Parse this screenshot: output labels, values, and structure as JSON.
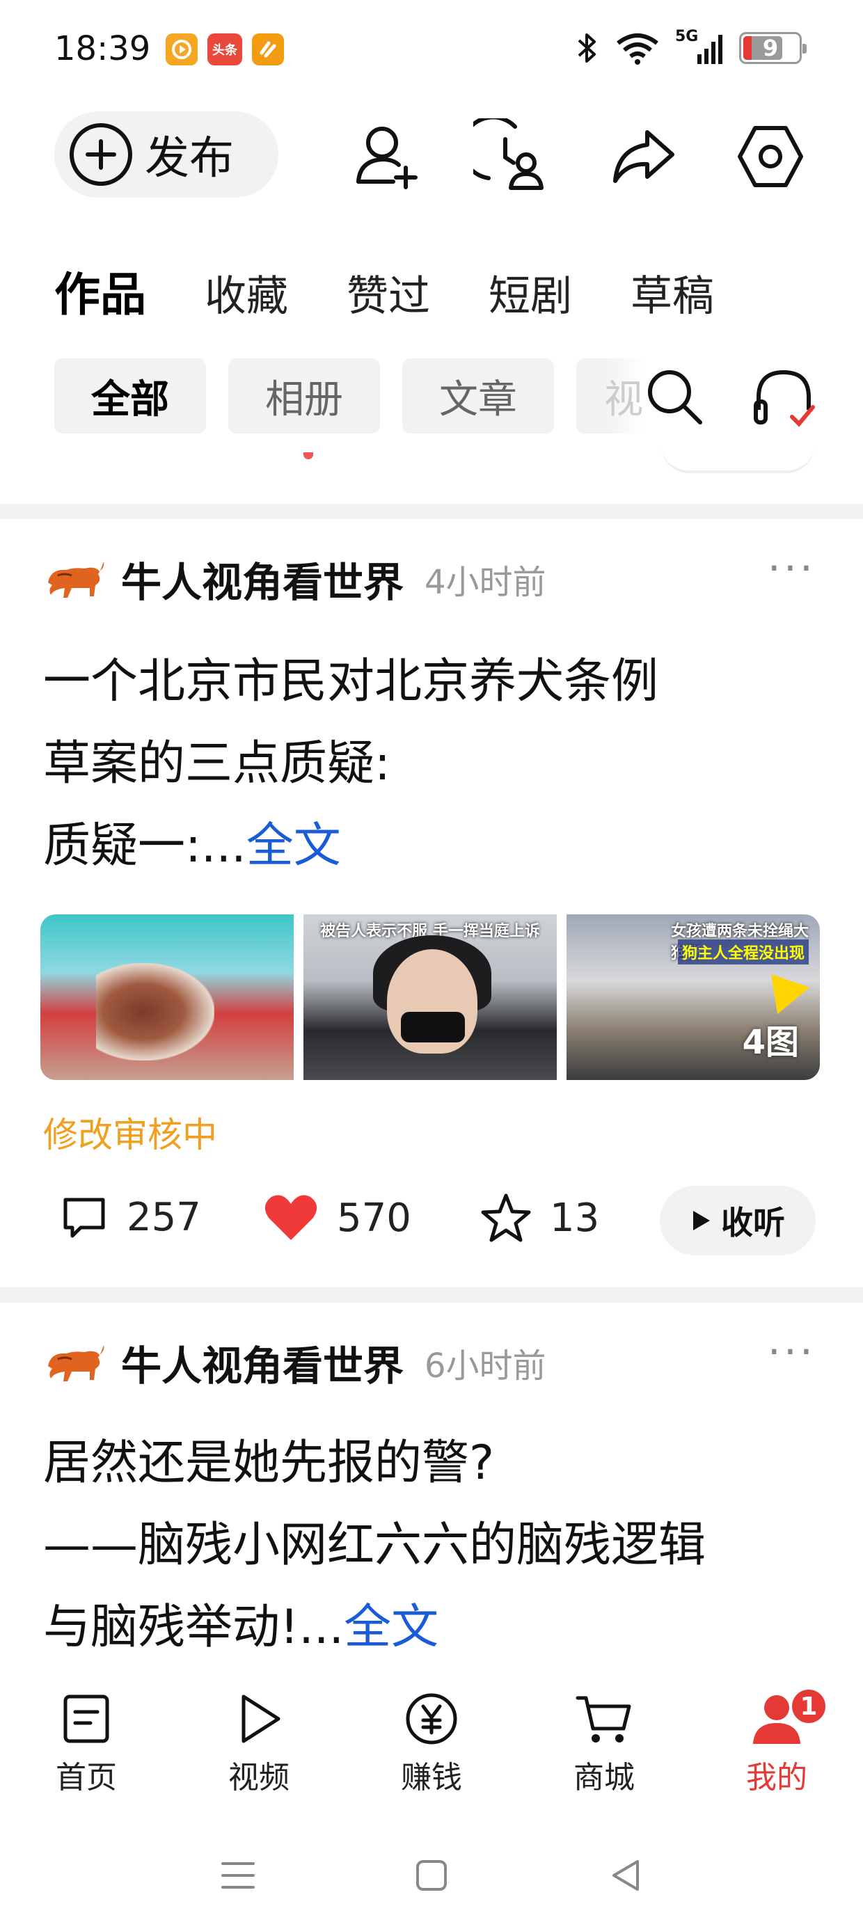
{
  "status_bar": {
    "time": "18:39",
    "app_badges": [
      "video-app-icon",
      "toutiao-icon",
      "app-icon"
    ],
    "toutiao_text": "头条",
    "network": "5G",
    "battery_level": "9"
  },
  "toolbar": {
    "publish_label": "发布",
    "icons": [
      "add-friend-icon",
      "history-icon",
      "share-icon",
      "settings-icon"
    ]
  },
  "tabs": [
    {
      "label": "作品",
      "active": true
    },
    {
      "label": "收藏",
      "active": false
    },
    {
      "label": "赞过",
      "active": false
    },
    {
      "label": "短剧",
      "active": false
    },
    {
      "label": "草稿",
      "active": false
    }
  ],
  "filters": [
    {
      "label": "全部",
      "active": true
    },
    {
      "label": "相册",
      "active": false
    },
    {
      "label": "文章",
      "active": false
    },
    {
      "label": "视",
      "active": false
    }
  ],
  "posts": [
    {
      "author": "牛人视角看世界",
      "time": "4小时前",
      "text_line1": "一个北京市民对北京养犬条例",
      "text_line2": "草案的三点质疑:",
      "text_line3": "质疑一:...",
      "full_text_link": "全文",
      "thumb_caption_2": "被告人表示不服 手一挥当庭上诉",
      "thumb_caption_3a": "女孩遭两条未拴绳大狗撕",
      "thumb_caption_3b": "狗主人全程没出现",
      "image_count": "4图",
      "status": "修改审核中",
      "comments": "257",
      "likes": "570",
      "favorites": "13",
      "listen_label": "收听"
    },
    {
      "author": "牛人视角看世界",
      "time": "6小时前",
      "text_line1": "居然还是她先报的警?",
      "text_line2": "——脑残小网红六六的脑残逻辑",
      "text_line3": "与脑残举动!...",
      "full_text_link": "全文"
    }
  ],
  "bottom_nav": [
    {
      "label": "首页",
      "icon": "home-doc-icon",
      "active": false
    },
    {
      "label": "视频",
      "icon": "play-icon",
      "active": false
    },
    {
      "label": "赚钱",
      "icon": "yuan-icon",
      "active": false
    },
    {
      "label": "商城",
      "icon": "cart-icon",
      "active": false
    },
    {
      "label": "我的",
      "icon": "profile-icon",
      "active": true,
      "badge": "1"
    }
  ],
  "colors": {
    "accent_red": "#e53935",
    "link_blue": "#1a5bd6",
    "review_orange": "#f0a020",
    "chip_bg": "#f2f2f4"
  }
}
